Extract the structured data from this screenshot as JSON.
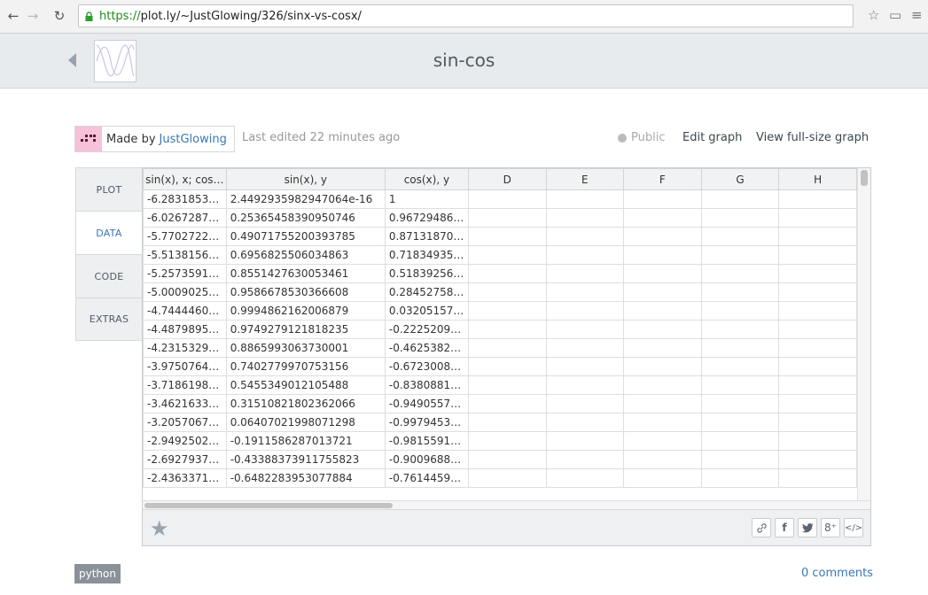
{
  "browser": {
    "url_scheme": "https://",
    "url_rest": "plot.ly/~JustGlowing/326/sinx-vs-cosx/"
  },
  "graph": {
    "title": "sin-cos"
  },
  "meta": {
    "made_by_label": "Made by",
    "author": "JustGlowing",
    "last_edited": "Last edited 22 minutes ago",
    "visibility": "Public",
    "edit_graph": "Edit graph",
    "view_full_size": "View full-size graph"
  },
  "tabs": [
    {
      "label": "PLOT",
      "active": false
    },
    {
      "label": "DATA",
      "active": true
    },
    {
      "label": "CODE",
      "active": false
    },
    {
      "label": "EXTRAS",
      "active": false
    }
  ],
  "grid": {
    "columns": [
      "sin(x), x; cos…",
      "sin(x), y",
      "cos(x), y",
      "D",
      "E",
      "F",
      "G",
      "H"
    ],
    "rows": [
      [
        "-6.2831853…",
        "2.4492935982947064e-16",
        "1"
      ],
      [
        "-6.0267287…",
        "0.25365458390950746",
        "0.96729486…"
      ],
      [
        "-5.7702722…",
        "0.49071755200393785",
        "0.87131870…"
      ],
      [
        "-5.5138156…",
        "0.6956825506034863",
        "0.71834935…"
      ],
      [
        "-5.2573591…",
        "0.8551427630053461",
        "0.51839256…"
      ],
      [
        "-5.0009025…",
        "0.9586678530366608",
        "0.28452758…"
      ],
      [
        "-4.7444460…",
        "0.9994862162006879",
        "0.03205157…"
      ],
      [
        "-4.4879895…",
        "0.9749279121818235",
        "-0.2225209…"
      ],
      [
        "-4.2315329…",
        "0.8865993063730001",
        "-0.4625382…"
      ],
      [
        "-3.9750764…",
        "0.7402779970753156",
        "-0.6723008…"
      ],
      [
        "-3.7186198…",
        "0.5455349012105488",
        "-0.8380881…"
      ],
      [
        "-3.4621633…",
        "0.31510821802362066",
        "-0.9490557…"
      ],
      [
        "-3.2057067…",
        "0.06407021998071298",
        "-0.9979453…"
      ],
      [
        "-2.9492502…",
        "-0.1911586287013721",
        "-0.9815591…"
      ],
      [
        "-2.6927937…",
        "-0.43388373911755823",
        "-0.9009688…"
      ],
      [
        "-2.4363371…",
        "-0.6482283953077884",
        "-0.7614459…"
      ]
    ]
  },
  "share": [
    "link-icon",
    "facebook-icon",
    "twitter-icon",
    "google-plus-icon",
    "embed-icon"
  ],
  "share_glyphs": {
    "f": "f",
    "tw": "🐦",
    "gp": "8⁺",
    "embed": "</>"
  },
  "footer": {
    "tag": "python",
    "comments": "0 comments"
  },
  "colors": {
    "accent": "#3a77b3",
    "header_bg": "#e8ebee",
    "avatar": "#f7c1da"
  }
}
